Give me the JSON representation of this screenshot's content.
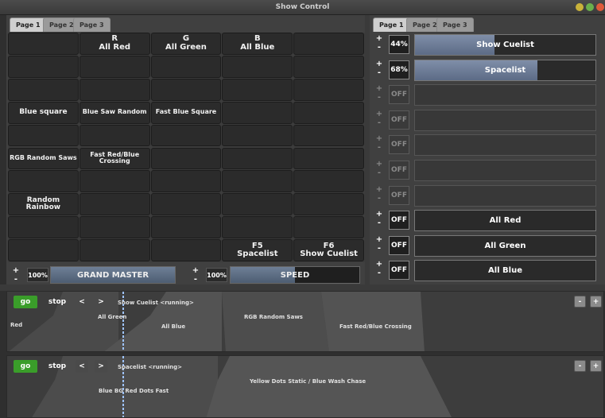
{
  "window": {
    "title": "Show Control"
  },
  "left_tabs": [
    "Page 1",
    "Page 2",
    "Page 3"
  ],
  "right_tabs": [
    "Page 1",
    "Page 2",
    "Page 3"
  ],
  "grid": [
    [
      "",
      "R\nAll Red",
      "G\nAll Green",
      "B\nAll Blue",
      ""
    ],
    [
      "",
      "",
      "",
      "",
      ""
    ],
    [
      "",
      "",
      "",
      "",
      ""
    ],
    [
      "Blue square",
      "Blue Saw Random",
      "Fast Blue Square",
      "",
      ""
    ],
    [
      "",
      "",
      "",
      "",
      ""
    ],
    [
      "RGB Random Saws",
      "Fast Red/Blue\nCrossing",
      "",
      "",
      ""
    ],
    [
      "",
      "",
      "",
      "",
      ""
    ],
    [
      "Random Rainbow",
      "",
      "",
      "",
      ""
    ],
    [
      "",
      "",
      "",
      "",
      ""
    ],
    [
      "",
      "",
      "",
      "F5\nSpacelist",
      "F6\nShow Cuelist"
    ]
  ],
  "grand_master": {
    "plus": "+",
    "minus": "-",
    "value": "100%",
    "label": "GRAND MASTER",
    "level": 1.0
  },
  "speed": {
    "plus": "+",
    "minus": "-",
    "value": "100%",
    "label": "SPEED",
    "level": 0.5
  },
  "cuelists": [
    {
      "value": "44%",
      "label": "Show Cuelist",
      "level": 0.44,
      "active": true
    },
    {
      "value": "68%",
      "label": "Spacelist",
      "level": 0.68,
      "active": true
    },
    {
      "value": "OFF",
      "label": "",
      "level": 0,
      "active": false
    },
    {
      "value": "OFF",
      "label": "",
      "level": 0,
      "active": false
    },
    {
      "value": "OFF",
      "label": "",
      "level": 0,
      "active": false
    },
    {
      "value": "OFF",
      "label": "",
      "level": 0,
      "active": false
    },
    {
      "value": "OFF",
      "label": "",
      "level": 0,
      "active": false
    },
    {
      "value": "OFF",
      "label": "All Red",
      "level": 0,
      "active": true
    },
    {
      "value": "OFF",
      "label": "All Green",
      "level": 0,
      "active": true
    },
    {
      "value": "OFF",
      "label": "All Blue",
      "level": 0,
      "active": true
    }
  ],
  "cuelist_pm": {
    "plus": "+",
    "minus": "-"
  },
  "seq1": {
    "go": "go",
    "stop": "stop",
    "prev": "<",
    "next": ">",
    "name": "Show Cuelist <running>",
    "cues": [
      "Red",
      "All Green",
      "All Blue",
      "RGB Random Saws",
      "Fast Red/Blue Crossing"
    ],
    "minus": "-",
    "plus": "+"
  },
  "seq2": {
    "go": "go",
    "stop": "stop",
    "prev": "<",
    "next": ">",
    "name": "Spacelist <running>",
    "cues": [
      "Blue BG Red Dots Fast",
      "Yellow Dots Static / Blue Wash Chase"
    ],
    "minus": "-",
    "plus": "+"
  },
  "colors": {
    "go": "#3a9d2a",
    "close": "#e05a3a",
    "min": "#c9b23a",
    "max": "#6ab04c"
  }
}
